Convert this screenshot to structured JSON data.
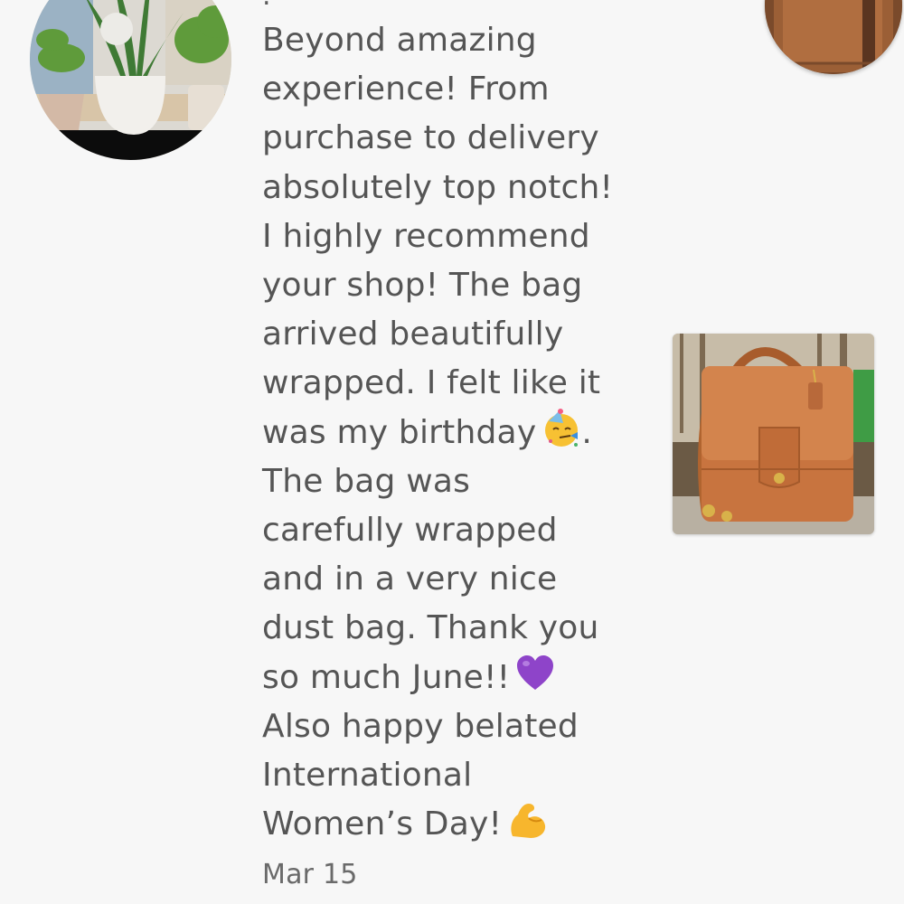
{
  "review": {
    "lines": [
      "Beyond amazing",
      "experience! From",
      "purchase to delivery",
      "absolutely top notch!",
      "I highly recommend",
      "your shop! The bag",
      "arrived beautifully",
      "wrapped. I felt like it",
      "was my birthday",
      ".",
      "The bag was",
      "carefully wrapped",
      "and in a very nice",
      "dust bag. Thank you",
      "so much June!!",
      "Also happy belated",
      "International",
      "Women’s Day!"
    ],
    "date": "Mar 15"
  },
  "icons": {
    "birthday_emoji": "partying-face-icon",
    "heart_emoji": "purple-heart-icon",
    "muscle_emoji": "flexed-biceps-icon"
  },
  "colors": {
    "background": "#f7f7f7",
    "text": "#555555",
    "date_text": "#6a6a6a",
    "leather": "#c8743f",
    "heart": "#8e44c9"
  }
}
